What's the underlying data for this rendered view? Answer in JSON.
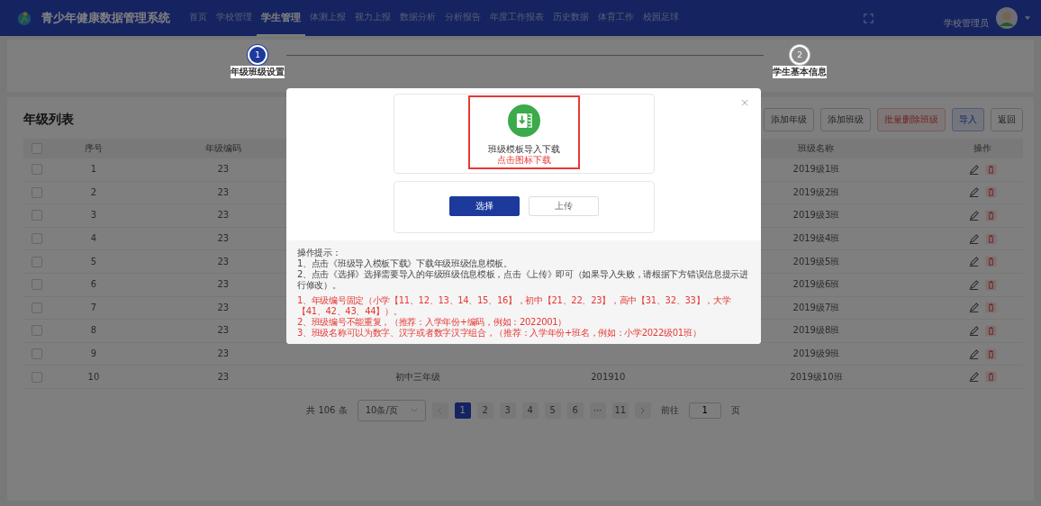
{
  "app": {
    "title": "青少年健康数据管理系统"
  },
  "nav": [
    {
      "label": "首页",
      "selected": false
    },
    {
      "label": "学校管理",
      "selected": false
    },
    {
      "label": "学生管理",
      "selected": true
    },
    {
      "label": "体测上报",
      "selected": false
    },
    {
      "label": "视力上报",
      "selected": false
    },
    {
      "label": "数据分析",
      "selected": false
    },
    {
      "label": "分析报告",
      "selected": false
    },
    {
      "label": "年度工作报表",
      "selected": false
    },
    {
      "label": "历史数据",
      "selected": false
    },
    {
      "label": "体育工作",
      "selected": false
    },
    {
      "label": "校园足球",
      "selected": false
    }
  ],
  "user": {
    "role": "学校管理员"
  },
  "steps": [
    {
      "number": "1",
      "label": "年级班级设置",
      "selected": true
    },
    {
      "number": "2",
      "label": "学生基本信息",
      "selected": false
    }
  ],
  "card": {
    "title": "年级列表"
  },
  "toolbar": [
    {
      "label": "添加年级",
      "kind": "default"
    },
    {
      "label": "添加班级",
      "kind": "default"
    },
    {
      "label": "批量删除班级",
      "kind": "danger"
    },
    {
      "label": "导入",
      "kind": "primary"
    },
    {
      "label": "返回",
      "kind": "default"
    }
  ],
  "table": {
    "header_checked": false,
    "columns": [
      "序号",
      "年级编码",
      "",
      "",
      "班级名称",
      "操作"
    ],
    "rows": [
      {
        "checked": false,
        "seq": "1",
        "grade_code": "23",
        "class_name": "2019级1班"
      },
      {
        "checked": false,
        "seq": "2",
        "grade_code": "23",
        "class_name": "2019级2班"
      },
      {
        "checked": false,
        "seq": "3",
        "grade_code": "23",
        "class_name": "2019级3班"
      },
      {
        "checked": false,
        "seq": "4",
        "grade_code": "23",
        "class_name": "2019级4班"
      },
      {
        "checked": false,
        "seq": "5",
        "grade_code": "23",
        "class_name": "2019级5班"
      },
      {
        "checked": false,
        "seq": "6",
        "grade_code": "23",
        "class_name": "2019级6班"
      },
      {
        "checked": false,
        "seq": "7",
        "grade_code": "23",
        "class_name": "2019级7班"
      },
      {
        "checked": false,
        "seq": "8",
        "grade_code": "23",
        "class_name": "2019级8班"
      },
      {
        "checked": false,
        "seq": "9",
        "grade_code": "23",
        "class_name": "2019级9班"
      },
      {
        "checked": false,
        "seq": "10",
        "grade_code": "23",
        "column_3": "初中三年级",
        "column_4": "201910",
        "class_name": "2019级10班"
      }
    ]
  },
  "pagination": {
    "total": "共 106 条",
    "page_size": "10条/页",
    "pages": [
      {
        "label": "1",
        "selected": true
      },
      {
        "label": "2",
        "selected": false
      },
      {
        "label": "3",
        "selected": false
      },
      {
        "label": "4",
        "selected": false
      },
      {
        "label": "5",
        "selected": false
      },
      {
        "label": "6",
        "selected": false
      },
      {
        "label": "···",
        "selected": false
      },
      {
        "label": "11",
        "selected": false
      }
    ],
    "goto_label": "前往",
    "goto_value": "1",
    "goto_suffix": "页"
  },
  "modal": {
    "download_title": "班级模板导入下载",
    "download_hint": "点击图标下载",
    "highlighted": true,
    "select_button": "选择",
    "upload_button": "上传",
    "tips_title": "操作提示：",
    "tips": [
      "1、点击《班级导入模板下载》下载年级班级信息模板。",
      "2、点击《选择》选择需要导入的年级班级信息模板，点击《上传》即可（如果导入失败，请根据下方错误信息提示进行修改）。"
    ],
    "rules": [
      "1、年级编号固定（小学【11、12、13、14、15、16】，初中【21、22、23】，高中【31、32、33】，大学【41、42、43、44】）。",
      "2、班级编号不能重复，（推荐：入学年份+编码，例如：2022001）",
      "3、班级名称可以为数字、汉字或者数字汉字组合，（推荐：入学年份+班名，例如：小学2022级01班）"
    ]
  }
}
